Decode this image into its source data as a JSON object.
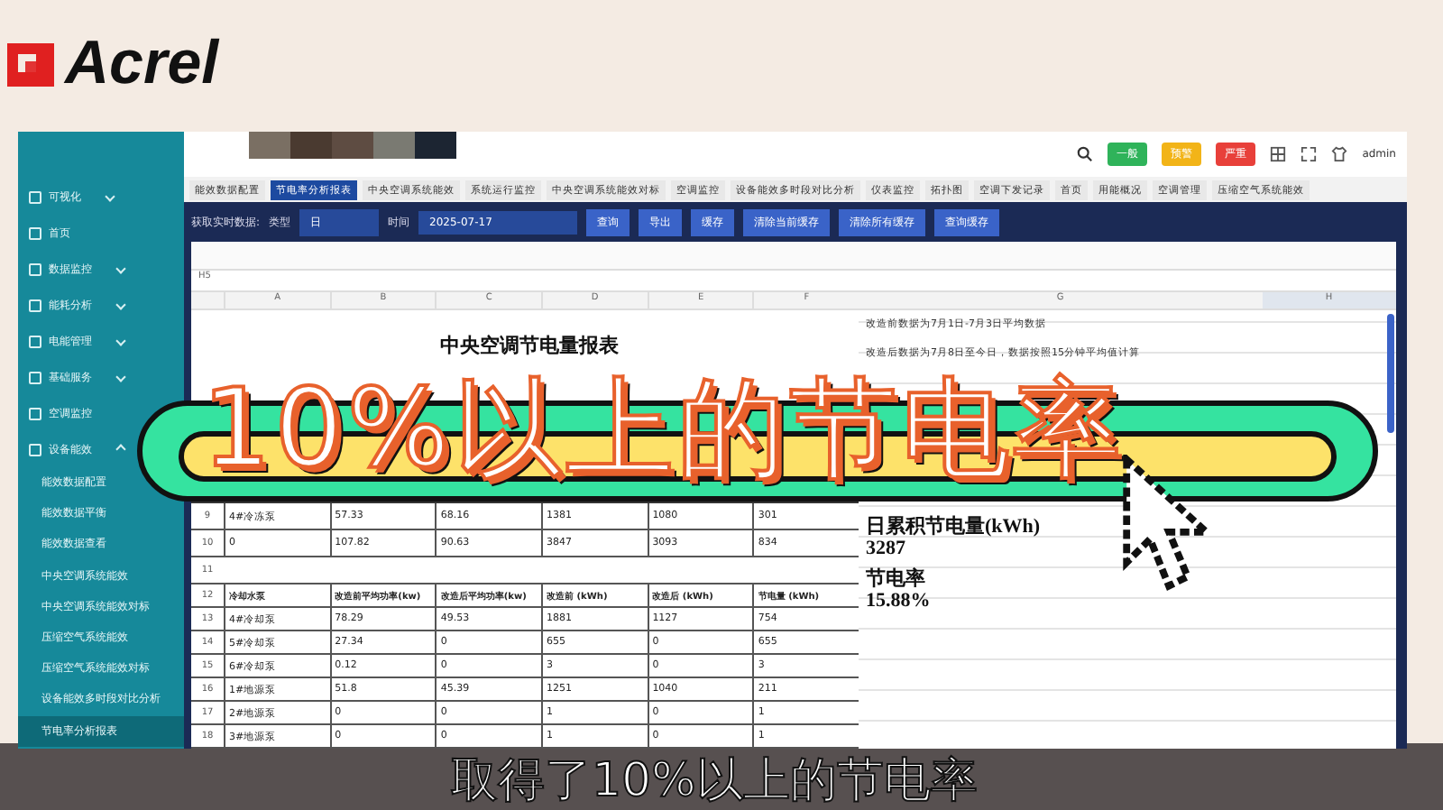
{
  "logo": {
    "text": "Acrel"
  },
  "header": {
    "badges": [
      {
        "label": "一般",
        "color": "#2fb35a"
      },
      {
        "label": "预警",
        "color": "#f2b418"
      },
      {
        "label": "严重",
        "color": "#e8403a"
      }
    ],
    "user": "admin"
  },
  "sidebar": {
    "items": [
      {
        "label": "可视化",
        "kind": "group",
        "expanded": false
      },
      {
        "label": "首页",
        "kind": "link"
      },
      {
        "label": "数据监控",
        "kind": "group",
        "expanded": false
      },
      {
        "label": "能耗分析",
        "kind": "group",
        "expanded": false
      },
      {
        "label": "电能管理",
        "kind": "group",
        "expanded": false
      },
      {
        "label": "基础服务",
        "kind": "group",
        "expanded": false
      },
      {
        "label": "空调监控",
        "kind": "link"
      },
      {
        "label": "设备能效",
        "kind": "group",
        "expanded": true,
        "children": [
          {
            "label": "能效数据配置",
            "selected": false
          },
          {
            "label": "能效数据平衡",
            "selected": false
          },
          {
            "label": "能效数据查看",
            "selected": false
          },
          {
            "label": "中央空调系统能效",
            "selected": false
          },
          {
            "label": "中央空调系统能效对标",
            "selected": false
          },
          {
            "label": "压缩空气系统能效",
            "selected": false
          },
          {
            "label": "压缩空气系统能效对标",
            "selected": false
          },
          {
            "label": "设备能效多时段对比分析",
            "selected": false
          },
          {
            "label": "节电率分析报表",
            "selected": true
          }
        ]
      }
    ]
  },
  "tabs": [
    {
      "label": "能效数据配置",
      "selected": false
    },
    {
      "label": "节电率分析报表",
      "selected": true
    },
    {
      "label": "中央空调系统能效",
      "selected": false
    },
    {
      "label": "系统运行监控",
      "selected": false
    },
    {
      "label": "中央空调系统能效对标",
      "selected": false
    },
    {
      "label": "空调监控",
      "selected": false
    },
    {
      "label": "设备能效多时段对比分析",
      "selected": false
    },
    {
      "label": "仪表监控",
      "selected": false
    },
    {
      "label": "拓扑图",
      "selected": false
    },
    {
      "label": "空调下发记录",
      "selected": false
    },
    {
      "label": "首页",
      "selected": false
    },
    {
      "label": "用能概况",
      "selected": false
    },
    {
      "label": "空调管理",
      "selected": false
    },
    {
      "label": "压缩空气系统能效",
      "selected": false
    }
  ],
  "toolbar": {
    "label": "获取实时数据:",
    "type_label": "类型",
    "type_value": "日",
    "time_label": "时间",
    "date": "2025-07-17",
    "buttons": [
      "查询",
      "导出",
      "缓存",
      "清除当前缓存",
      "清除所有缓存",
      "查询缓存"
    ]
  },
  "sheet": {
    "cell_ref": "H5",
    "columns": [
      "A",
      "B",
      "C",
      "D",
      "E",
      "F",
      "G",
      "H"
    ],
    "title": "中央空调节电量报表",
    "rows": [
      {
        "num": "9",
        "cells": [
          "4#冷冻泵",
          "57.33",
          "68.16",
          "1381",
          "1080",
          "301"
        ]
      },
      {
        "num": "10",
        "cells": [
          "0",
          "107.82",
          "90.63",
          "3847",
          "3093",
          "834"
        ]
      },
      {
        "num": "11",
        "cells": []
      },
      {
        "num": "12",
        "header": true,
        "cells": [
          "冷却水泵",
          "改造前平均功率(kw)",
          "改造后平均功率(kw)",
          "改造前 (kWh)",
          "改造后 (kWh)",
          "节电量 (kWh)"
        ]
      },
      {
        "num": "13",
        "cells": [
          "4#冷却泵",
          "78.29",
          "49.53",
          "1881",
          "1127",
          "754"
        ]
      },
      {
        "num": "14",
        "cells": [
          "5#冷却泵",
          "27.34",
          "0",
          "655",
          "0",
          "655"
        ]
      },
      {
        "num": "15",
        "cells": [
          "6#冷却泵",
          "0.12",
          "0",
          "3",
          "0",
          "3"
        ]
      },
      {
        "num": "16",
        "cells": [
          "1#地源泵",
          "51.8",
          "45.39",
          "1251",
          "1040",
          "211"
        ]
      },
      {
        "num": "17",
        "cells": [
          "2#地源泵",
          "0",
          "0",
          "1",
          "0",
          "1"
        ]
      },
      {
        "num": "18",
        "cells": [
          "3#地源泵",
          "0",
          "0",
          "1",
          "0",
          "1"
        ]
      }
    ],
    "notes": [
      "改造前数据为7月1日-7月3日平均数据",
      "改造后数据为7月8日至今日，数据按照15分钟平均值计算"
    ],
    "summary": [
      {
        "label": "日累积节电量(kWh)",
        "value": "3287"
      },
      {
        "label": "节电率",
        "value": "15.88%"
      }
    ]
  },
  "banner": {
    "text": "10%以上的节电率"
  },
  "subtitle": "取得了10%以上的节电率"
}
